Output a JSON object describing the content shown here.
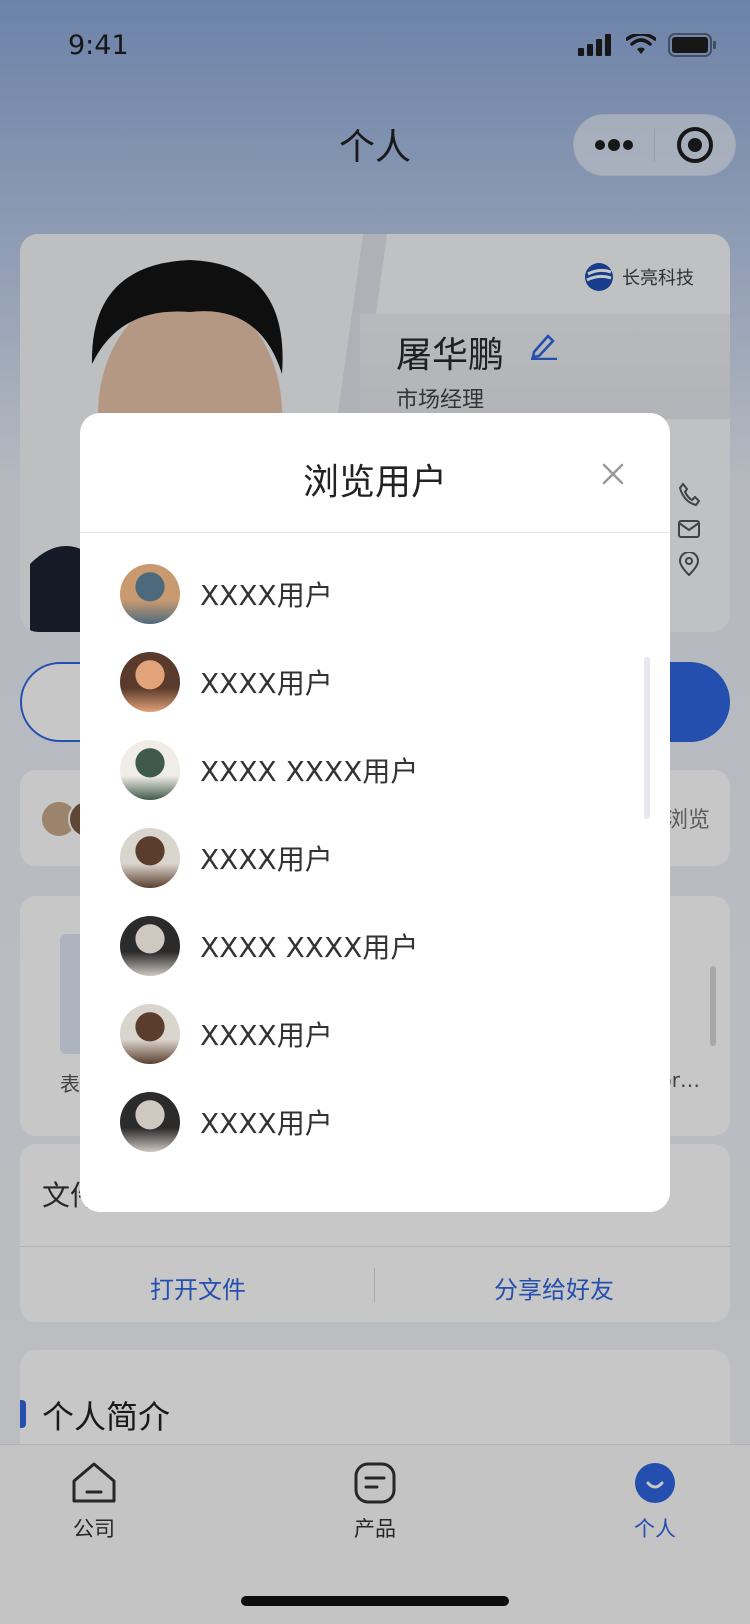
{
  "status_bar": {
    "time": "9:41"
  },
  "nav": {
    "title": "个人"
  },
  "profile": {
    "company_logo_text": "长亮科技",
    "name": "屠华鹏",
    "job_title": "市场经理"
  },
  "viewers": {
    "suffix_text": "浏览"
  },
  "files": {
    "left_label": "表",
    "right_label": "or…"
  },
  "file_card": {
    "label": "文件",
    "open_button": "打开文件",
    "share_button": "分享给好友"
  },
  "intro": {
    "title": "个人简介"
  },
  "modal": {
    "title": "浏览用户",
    "users": [
      {
        "name": "XXXX用户",
        "avatar_colors": [
          "#c99a70",
          "#4d6a7d"
        ]
      },
      {
        "name": "XXXX用户",
        "avatar_colors": [
          "#5a3a2a",
          "#e2a27a"
        ]
      },
      {
        "name": "XXXX XXXX用户",
        "avatar_colors": [
          "#f0ede6",
          "#3f5a4a"
        ]
      },
      {
        "name": "XXXX用户",
        "avatar_colors": [
          "#d9d4cc",
          "#5a3d2d"
        ]
      },
      {
        "name": "XXXX XXXX用户",
        "avatar_colors": [
          "#2b2b2b",
          "#cfc8c0"
        ]
      },
      {
        "name": "XXXX用户",
        "avatar_colors": [
          "#d9d4cc",
          "#5a3d2d"
        ]
      },
      {
        "name": "XXXX用户",
        "avatar_colors": [
          "#2b2b2b",
          "#cfc8c0"
        ]
      }
    ]
  },
  "tabbar": {
    "tabs": [
      {
        "label": "公司"
      },
      {
        "label": "产品"
      },
      {
        "label": "个人"
      }
    ]
  },
  "colors": {
    "accent": "#2f66e0"
  }
}
